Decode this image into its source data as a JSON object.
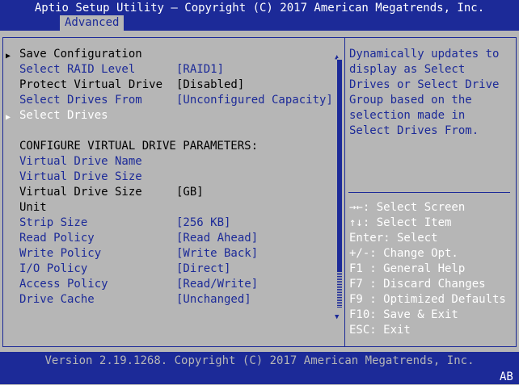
{
  "header": {
    "title": "Aptio Setup Utility – Copyright (C) 2017 American Megatrends, Inc.",
    "active_tab": "Advanced"
  },
  "menu": {
    "save_configuration": "Save Configuration",
    "select_raid_level": {
      "label": "Select RAID Level",
      "value": "[RAID1]"
    },
    "protect_virtual_drive": {
      "label": "Protect Virtual Drive",
      "value": "[Disabled]"
    },
    "select_drives_from": {
      "label": "Select Drives From",
      "value": "[Unconfigured Capacity]"
    },
    "select_drives": "Select Drives",
    "section_heading": "CONFIGURE VIRTUAL DRIVE PARAMETERS:",
    "virtual_drive_name": "Virtual Drive Name",
    "virtual_drive_size_field": "Virtual Drive Size",
    "virtual_drive_size_unit": {
      "label": "Virtual Drive Size",
      "value": "[GB]",
      "label_cont": "Unit"
    },
    "strip_size": {
      "label": "Strip Size",
      "value": "[256 KB]"
    },
    "read_policy": {
      "label": "Read Policy",
      "value": "[Read Ahead]"
    },
    "write_policy": {
      "label": "Write Policy",
      "value": "[Write Back]"
    },
    "io_policy": {
      "label": "I/O Policy",
      "value": "[Direct]"
    },
    "access_policy": {
      "label": "Access Policy",
      "value": "[Read/Write]"
    },
    "drive_cache": {
      "label": "Drive Cache",
      "value": "[Unchanged]"
    }
  },
  "help": {
    "lines": [
      "Dynamically updates to",
      "display as Select",
      "Drives or Select Drive",
      "Group based on the",
      "selection made in",
      "Select Drives From."
    ]
  },
  "keys": [
    "→←: Select Screen",
    "↑↓: Select Item",
    "Enter: Select",
    "+/-: Change Opt.",
    "F1 : General Help",
    "F7 : Discard Changes",
    "F9 : Optimized Defaults",
    "F10: Save & Exit",
    "ESC: Exit"
  ],
  "footer": {
    "version": "Version 2.19.1268. Copyright (C) 2017 American Megatrends, Inc.",
    "badge": "AB"
  },
  "colors": {
    "bios_blue": "#1c2a98",
    "bios_gray": "#b6b6b6",
    "white": "#ffffff",
    "black": "#000000"
  }
}
